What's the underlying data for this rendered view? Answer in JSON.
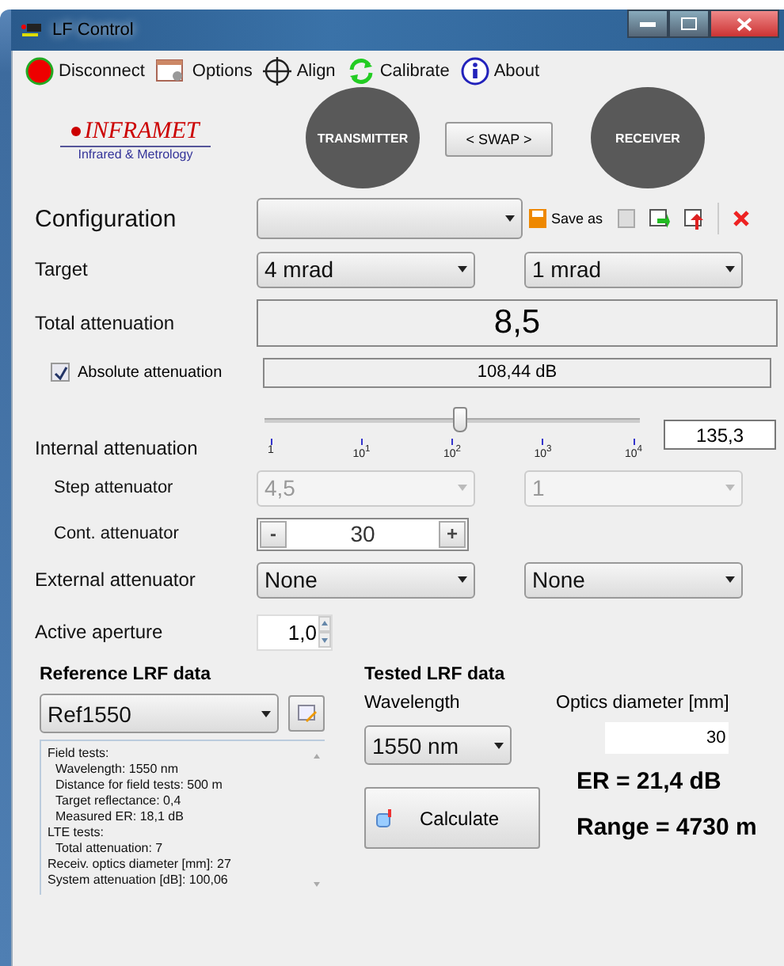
{
  "window": {
    "title": "LF Control"
  },
  "toolbar": [
    {
      "kind": "disconnect",
      "label": "Disconnect"
    },
    {
      "kind": "options",
      "label": "Options"
    },
    {
      "kind": "align",
      "label": "Align"
    },
    {
      "kind": "calibrate",
      "label": "Calibrate"
    },
    {
      "kind": "about",
      "label": "About"
    }
  ],
  "logo": {
    "name": "INFRAMET",
    "tagline": "Infrared & Metrology"
  },
  "devices": {
    "left": "TRANSMITTER",
    "swap": "< SWAP >",
    "right": "RECEIVER"
  },
  "configuration": {
    "label": "Configuration",
    "save_as": "Save as"
  },
  "target": {
    "label": "Target",
    "values": [
      "4 mrad",
      "1 mrad"
    ]
  },
  "total_attenuation": {
    "label": "Total attenuation",
    "value": "8,5"
  },
  "absolute_attenuation": {
    "label": "Absolute attenuation",
    "checked": true,
    "value": "108,44 dB"
  },
  "internal_attenuation": {
    "label": "Internal attenuation",
    "level": 0.52,
    "ticks": [
      "1",
      "10$^{1}$",
      "10$^{2}$",
      "10$^{3}$",
      "10$^{4}$"
    ],
    "value": "135,3"
  },
  "step_attenuator": {
    "label": "Step attenuator",
    "disabled": true,
    "values": [
      "4,5",
      "1"
    ]
  },
  "cont_attenuator": {
    "label": "Cont. attenuator",
    "minus": "-",
    "value": "30",
    "plus": "+"
  },
  "external_attenuator": {
    "label": "External attenuator",
    "values": [
      "None",
      "None"
    ]
  },
  "active_aperture": {
    "label": "Active aperture",
    "value": "1,0"
  },
  "reference": {
    "heading": "Reference LRF data",
    "selection": "Ref1550",
    "details": [
      {
        "text": "Field tests:",
        "children": [
          {
            "text": "Wavelength: 1550 nm"
          },
          {
            "text": "Distance for field tests: 500 m"
          },
          {
            "text": "Target reflectance: 0,4"
          },
          {
            "text": "Measured ER: 18,1 dB"
          }
        ]
      },
      {
        "text": "LTE tests:",
        "children": [
          {
            "text": "Total attenuation: 7"
          }
        ]
      },
      {
        "text": "Receiv. optics diameter [mm]: 27"
      },
      {
        "text": "System attenuation [dB]: 100,06"
      }
    ]
  },
  "tested": {
    "heading": "Tested LRF data",
    "wavelength_label": "Wavelength",
    "wavelength": "1550 nm",
    "optics_label": "Optics diameter [mm]",
    "optics_value": "30",
    "calculate": "Calculate",
    "er": "ER = 21,4 dB",
    "range": "Range = 4730 m"
  }
}
